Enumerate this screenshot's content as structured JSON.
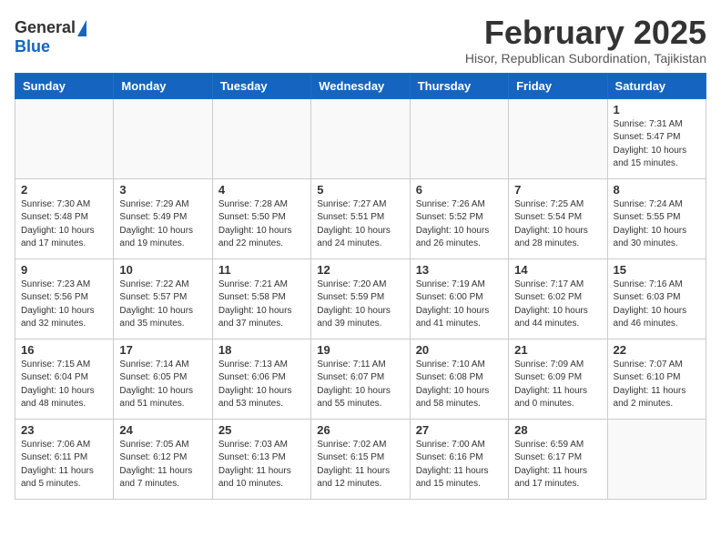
{
  "header": {
    "logo_general": "General",
    "logo_blue": "Blue",
    "month_title": "February 2025",
    "subtitle": "Hisor, Republican Subordination, Tajikistan"
  },
  "weekdays": [
    "Sunday",
    "Monday",
    "Tuesday",
    "Wednesday",
    "Thursday",
    "Friday",
    "Saturday"
  ],
  "weeks": [
    [
      {
        "day": "",
        "info": ""
      },
      {
        "day": "",
        "info": ""
      },
      {
        "day": "",
        "info": ""
      },
      {
        "day": "",
        "info": ""
      },
      {
        "day": "",
        "info": ""
      },
      {
        "day": "",
        "info": ""
      },
      {
        "day": "1",
        "info": "Sunrise: 7:31 AM\nSunset: 5:47 PM\nDaylight: 10 hours\nand 15 minutes."
      }
    ],
    [
      {
        "day": "2",
        "info": "Sunrise: 7:30 AM\nSunset: 5:48 PM\nDaylight: 10 hours\nand 17 minutes."
      },
      {
        "day": "3",
        "info": "Sunrise: 7:29 AM\nSunset: 5:49 PM\nDaylight: 10 hours\nand 19 minutes."
      },
      {
        "day": "4",
        "info": "Sunrise: 7:28 AM\nSunset: 5:50 PM\nDaylight: 10 hours\nand 22 minutes."
      },
      {
        "day": "5",
        "info": "Sunrise: 7:27 AM\nSunset: 5:51 PM\nDaylight: 10 hours\nand 24 minutes."
      },
      {
        "day": "6",
        "info": "Sunrise: 7:26 AM\nSunset: 5:52 PM\nDaylight: 10 hours\nand 26 minutes."
      },
      {
        "day": "7",
        "info": "Sunrise: 7:25 AM\nSunset: 5:54 PM\nDaylight: 10 hours\nand 28 minutes."
      },
      {
        "day": "8",
        "info": "Sunrise: 7:24 AM\nSunset: 5:55 PM\nDaylight: 10 hours\nand 30 minutes."
      }
    ],
    [
      {
        "day": "9",
        "info": "Sunrise: 7:23 AM\nSunset: 5:56 PM\nDaylight: 10 hours\nand 32 minutes."
      },
      {
        "day": "10",
        "info": "Sunrise: 7:22 AM\nSunset: 5:57 PM\nDaylight: 10 hours\nand 35 minutes."
      },
      {
        "day": "11",
        "info": "Sunrise: 7:21 AM\nSunset: 5:58 PM\nDaylight: 10 hours\nand 37 minutes."
      },
      {
        "day": "12",
        "info": "Sunrise: 7:20 AM\nSunset: 5:59 PM\nDaylight: 10 hours\nand 39 minutes."
      },
      {
        "day": "13",
        "info": "Sunrise: 7:19 AM\nSunset: 6:00 PM\nDaylight: 10 hours\nand 41 minutes."
      },
      {
        "day": "14",
        "info": "Sunrise: 7:17 AM\nSunset: 6:02 PM\nDaylight: 10 hours\nand 44 minutes."
      },
      {
        "day": "15",
        "info": "Sunrise: 7:16 AM\nSunset: 6:03 PM\nDaylight: 10 hours\nand 46 minutes."
      }
    ],
    [
      {
        "day": "16",
        "info": "Sunrise: 7:15 AM\nSunset: 6:04 PM\nDaylight: 10 hours\nand 48 minutes."
      },
      {
        "day": "17",
        "info": "Sunrise: 7:14 AM\nSunset: 6:05 PM\nDaylight: 10 hours\nand 51 minutes."
      },
      {
        "day": "18",
        "info": "Sunrise: 7:13 AM\nSunset: 6:06 PM\nDaylight: 10 hours\nand 53 minutes."
      },
      {
        "day": "19",
        "info": "Sunrise: 7:11 AM\nSunset: 6:07 PM\nDaylight: 10 hours\nand 55 minutes."
      },
      {
        "day": "20",
        "info": "Sunrise: 7:10 AM\nSunset: 6:08 PM\nDaylight: 10 hours\nand 58 minutes."
      },
      {
        "day": "21",
        "info": "Sunrise: 7:09 AM\nSunset: 6:09 PM\nDaylight: 11 hours\nand 0 minutes."
      },
      {
        "day": "22",
        "info": "Sunrise: 7:07 AM\nSunset: 6:10 PM\nDaylight: 11 hours\nand 2 minutes."
      }
    ],
    [
      {
        "day": "23",
        "info": "Sunrise: 7:06 AM\nSunset: 6:11 PM\nDaylight: 11 hours\nand 5 minutes."
      },
      {
        "day": "24",
        "info": "Sunrise: 7:05 AM\nSunset: 6:12 PM\nDaylight: 11 hours\nand 7 minutes."
      },
      {
        "day": "25",
        "info": "Sunrise: 7:03 AM\nSunset: 6:13 PM\nDaylight: 11 hours\nand 10 minutes."
      },
      {
        "day": "26",
        "info": "Sunrise: 7:02 AM\nSunset: 6:15 PM\nDaylight: 11 hours\nand 12 minutes."
      },
      {
        "day": "27",
        "info": "Sunrise: 7:00 AM\nSunset: 6:16 PM\nDaylight: 11 hours\nand 15 minutes."
      },
      {
        "day": "28",
        "info": "Sunrise: 6:59 AM\nSunset: 6:17 PM\nDaylight: 11 hours\nand 17 minutes."
      },
      {
        "day": "",
        "info": ""
      }
    ]
  ]
}
